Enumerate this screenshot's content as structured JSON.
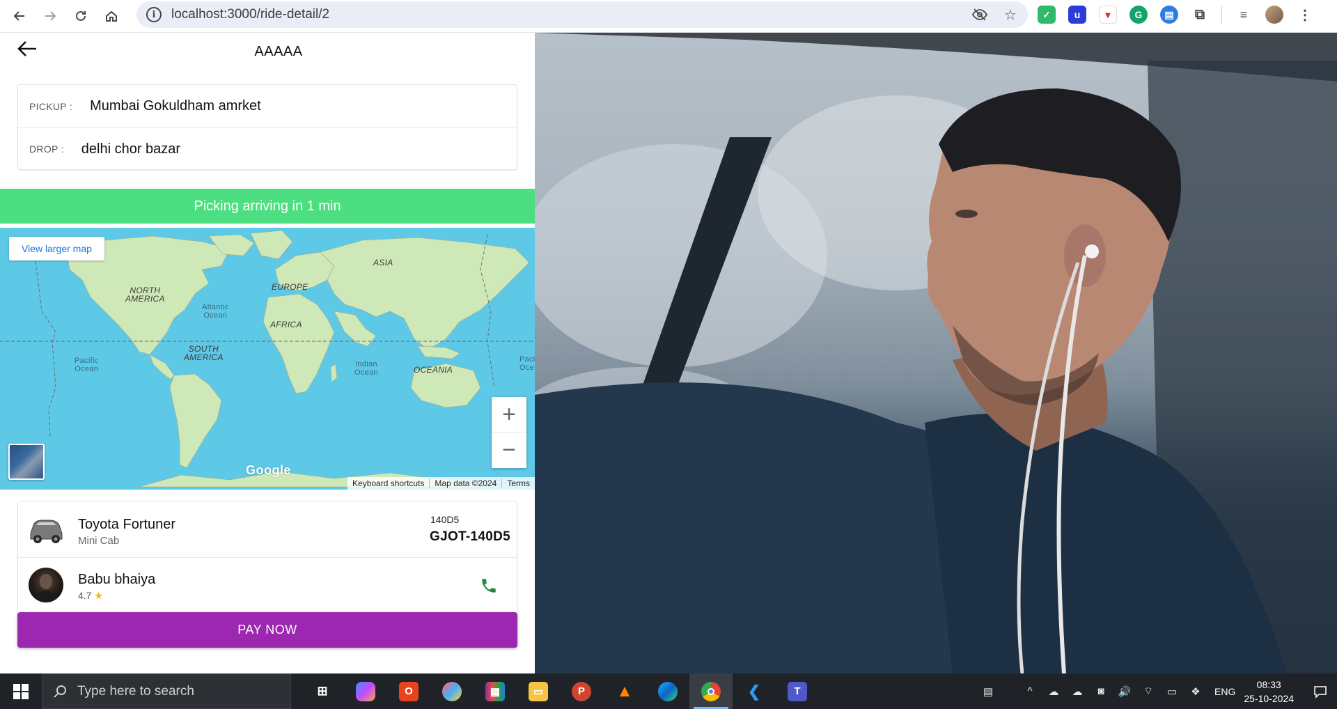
{
  "browser": {
    "url": "localhost:3000/ride-detail/2"
  },
  "app": {
    "title": "AAAAA",
    "pickup_label": "PICKUP :",
    "pickup_value": "Mumbai Gokuldham amrket",
    "drop_label": "DROP :",
    "drop_value": "delhi chor bazar",
    "status_text": "Picking arriving in 1 min",
    "map": {
      "view_larger": "View larger map",
      "labels": {
        "north_america": "NORTH\nAMERICA",
        "south_america": "SOUTH\nAMERICA",
        "europe": "EUROPE",
        "asia": "ASIA",
        "africa": "AFRICA",
        "oceania": "OCEANIA",
        "atlantic": "Atlantic\nOcean",
        "pacific": "Pacific\nOcean",
        "indian": "Indian\nOcean",
        "pacific_right": "Paci\nOce"
      },
      "zoom_in": "+",
      "zoom_out": "−",
      "logo": "Google",
      "attrib_shortcuts": "Keyboard shortcuts",
      "attrib_data": "Map data ©2024",
      "attrib_terms": "Terms"
    },
    "vehicle": {
      "name": "Toyota Fortuner",
      "type": "Mini Cab",
      "plate_short": "140D5",
      "plate_full": "GJOT-140D5"
    },
    "driver": {
      "name": "Babu bhaiya",
      "rating": "4.7"
    },
    "pay_button": "PAY NOW"
  },
  "taskbar": {
    "search_placeholder": "Type here to search",
    "lang": "ENG",
    "time": "08:33",
    "date": "25-10-2024"
  },
  "colors": {
    "status_green": "#4cde80",
    "pay_purple": "#9c27b0",
    "map_ocean": "#5ec9e6",
    "land": "#c8e6b0",
    "phone_green": "#1e8e3e"
  }
}
